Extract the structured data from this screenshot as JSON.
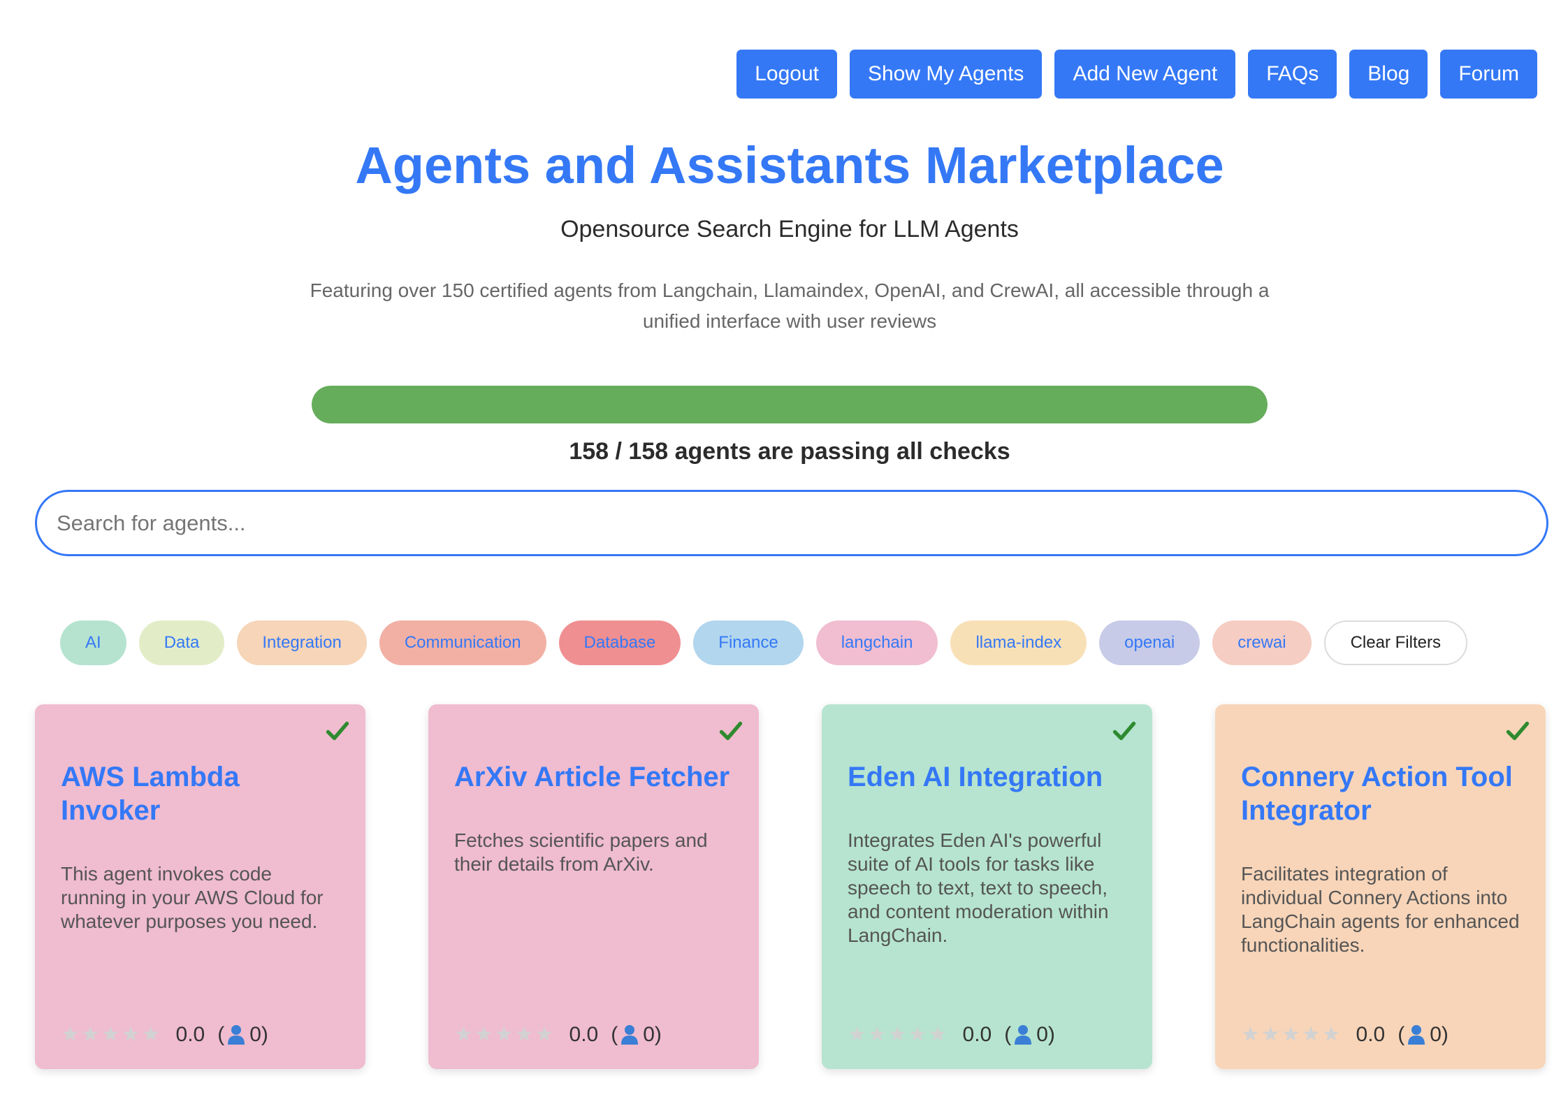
{
  "nav": {
    "buttons": [
      "Logout",
      "Show My Agents",
      "Add New Agent",
      "FAQs",
      "Blog",
      "Forum"
    ]
  },
  "header": {
    "title": "Agents and Assistants Marketplace",
    "subtitle": "Opensource Search Engine for LLM Agents",
    "description": "Featuring over 150 certified agents from Langchain, Llamaindex, OpenAI, and CrewAI, all accessible through a unified interface with user reviews"
  },
  "progress": {
    "passing": 158,
    "total": 158,
    "fraction": 1.0,
    "text": "158 / 158 agents are passing all checks",
    "color": "#66ad5b"
  },
  "search": {
    "placeholder": "Search for agents...",
    "value": ""
  },
  "filters": [
    {
      "label": "AI",
      "color": "#b5e3d0"
    },
    {
      "label": "Data",
      "color": "#e2edc8"
    },
    {
      "label": "Integration",
      "color": "#f6d5b8"
    },
    {
      "label": "Communication",
      "color": "#f2b0a5"
    },
    {
      "label": "Database",
      "color": "#ef8f92"
    },
    {
      "label": "Finance",
      "color": "#b1d6ee"
    },
    {
      "label": "langchain",
      "color": "#f0bed0"
    },
    {
      "label": "llama-index",
      "color": "#f8e0b6"
    },
    {
      "label": "openai",
      "color": "#c7cbe7"
    },
    {
      "label": "crewai",
      "color": "#f6cdc3"
    }
  ],
  "clear_filters_label": "Clear Filters",
  "cards": [
    {
      "title": "AWS Lambda Invoker",
      "description": "This agent invokes code running in your AWS Cloud for whatever purposes you need.",
      "rating": "0.0",
      "reviews": "0)",
      "bg": "#f0bccf",
      "verified_icon": "check-icon"
    },
    {
      "title": "ArXiv Article Fetcher",
      "description": "Fetches scientific papers and their details from ArXiv.",
      "rating": "0.0",
      "reviews": "0)",
      "bg": "#f0bccf",
      "verified_icon": "check-icon"
    },
    {
      "title": "Eden AI Integration",
      "description": "Integrates Eden AI's powerful suite of AI tools for tasks like speech to text, text to speech, and content moderation within LangChain.",
      "rating": "0.0",
      "reviews": "0)",
      "bg": "#b6e4d0",
      "verified_icon": "check-icon"
    },
    {
      "title": "Connery Action Tool Integrator",
      "description": "Facilitates integration of individual Connery Actions into LangChain agents for enhanced functionalities.",
      "rating": "0.0",
      "reviews": "0)",
      "bg": "#f8d5b9",
      "verified_icon": "check-icon"
    }
  ],
  "colors": {
    "accent": "#3478f6",
    "check": "#2f8a2f",
    "star_empty": "#d2d2d2"
  },
  "labels": {
    "paren_open": "("
  }
}
